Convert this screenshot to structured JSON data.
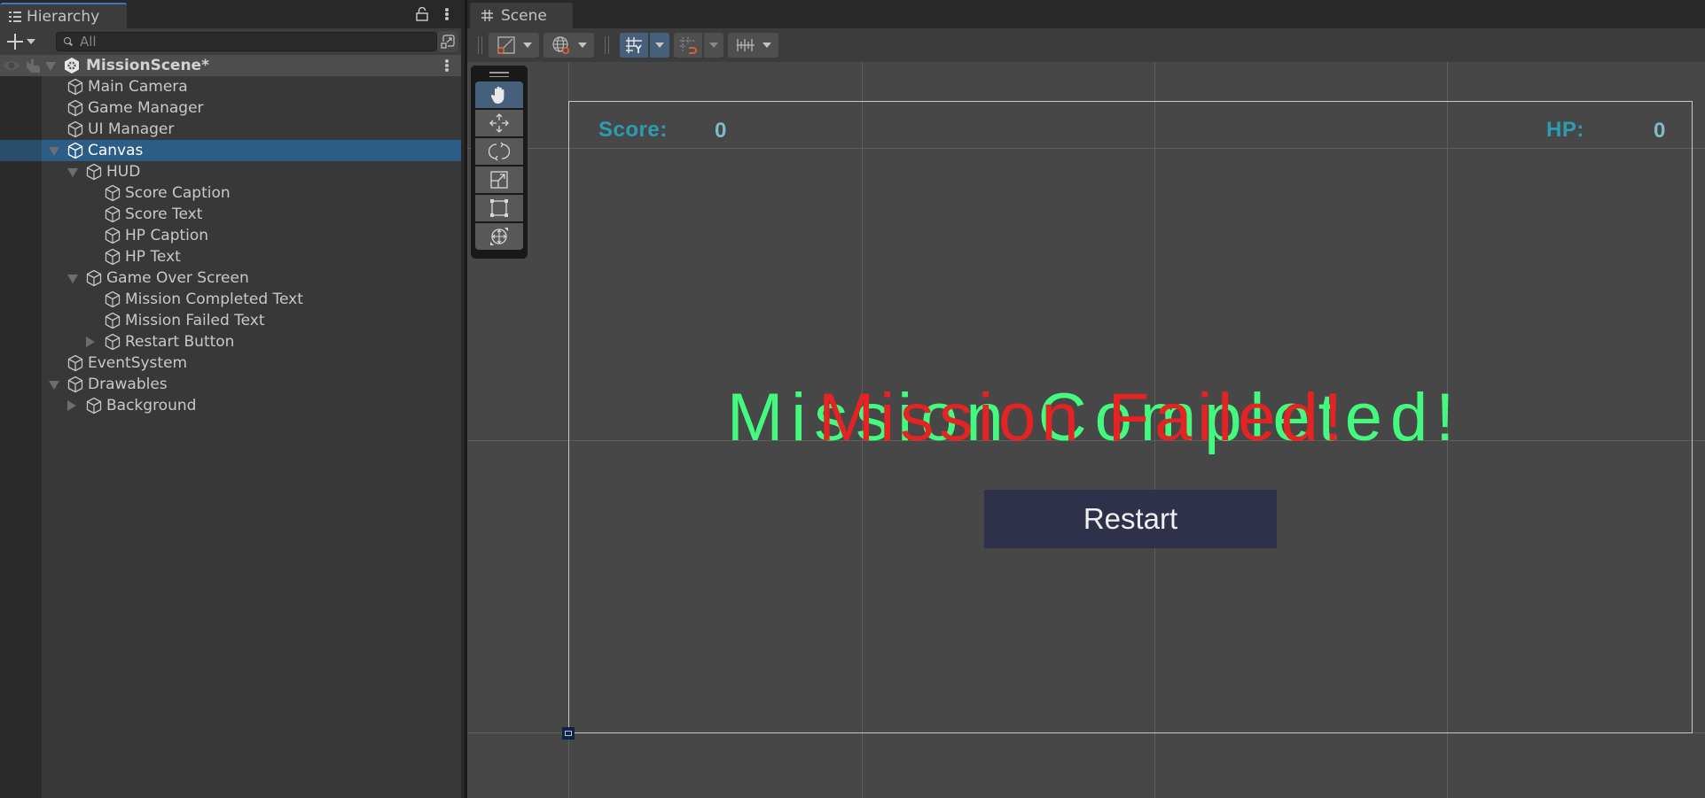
{
  "hierarchy": {
    "tab_label": "Hierarchy",
    "search_placeholder": "All",
    "scene_name": "MissionScene*",
    "items": [
      {
        "label": "Main Camera",
        "depth": 1,
        "foldout": "none"
      },
      {
        "label": "Game Manager",
        "depth": 1,
        "foldout": "none"
      },
      {
        "label": "UI Manager",
        "depth": 1,
        "foldout": "none"
      },
      {
        "label": "Canvas",
        "depth": 1,
        "foldout": "open",
        "selected": true
      },
      {
        "label": "HUD",
        "depth": 2,
        "foldout": "open"
      },
      {
        "label": "Score Caption",
        "depth": 3,
        "foldout": "none"
      },
      {
        "label": "Score Text",
        "depth": 3,
        "foldout": "none"
      },
      {
        "label": "HP Caption",
        "depth": 3,
        "foldout": "none"
      },
      {
        "label": "HP Text",
        "depth": 3,
        "foldout": "none"
      },
      {
        "label": "Game Over Screen",
        "depth": 2,
        "foldout": "open"
      },
      {
        "label": "Mission Completed Text",
        "depth": 3,
        "foldout": "none"
      },
      {
        "label": "Mission Failed Text",
        "depth": 3,
        "foldout": "none"
      },
      {
        "label": "Restart Button",
        "depth": 3,
        "foldout": "closed"
      },
      {
        "label": "EventSystem",
        "depth": 1,
        "foldout": "none"
      },
      {
        "label": "Drawables",
        "depth": 1,
        "foldout": "open"
      },
      {
        "label": "Background",
        "depth": 2,
        "foldout": "closed"
      }
    ]
  },
  "scene": {
    "tab_label": "Scene",
    "toolbar": {
      "tools": [
        "gizmo-handle-tool",
        "global-local-tool",
        "grid-snapping-toggle",
        "increment-snapping-toggle",
        "ruler-tool"
      ],
      "grid_snapping_active": true
    },
    "tools_overlay": {
      "tools": [
        "hand",
        "move",
        "rotate",
        "scale",
        "rect",
        "transform"
      ],
      "active": "hand"
    },
    "game_view": {
      "score_caption": "Score:",
      "score_value": "0",
      "hp_caption": "HP:",
      "hp_value": "0",
      "mission_completed_text": "Mission Completed!",
      "mission_failed_text": "Mission Failed!",
      "restart_label": "Restart"
    }
  },
  "colors": {
    "selection": "#2c5d87",
    "hud_caption": "#2b9db3",
    "hud_value": "#7fbcc9",
    "completed_text": "#43fa7e",
    "failed_text": "#e62323",
    "restart_button": "#2e3149",
    "active_tool": "#46607c"
  }
}
